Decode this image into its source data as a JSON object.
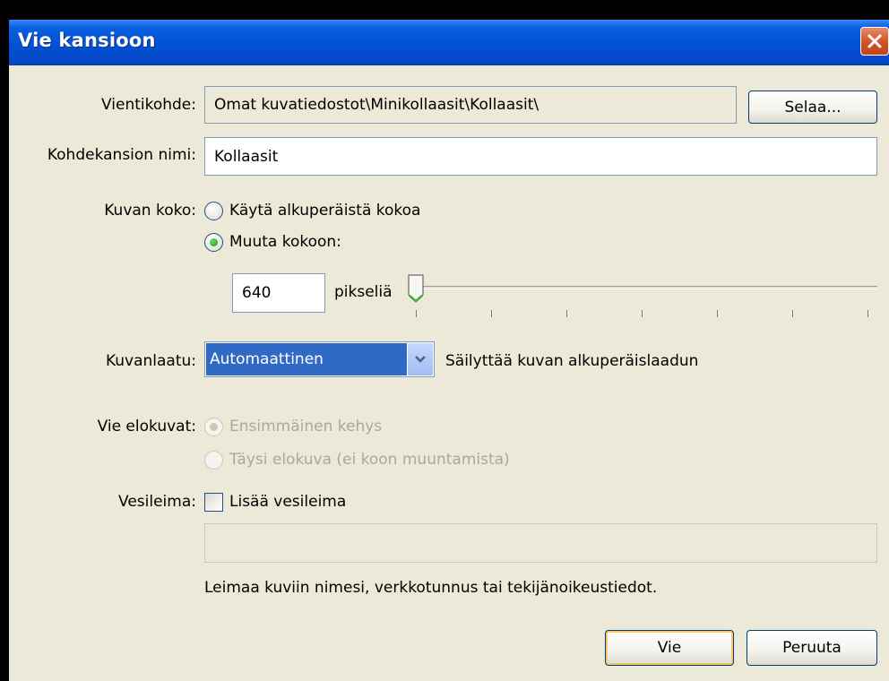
{
  "window": {
    "title": "Vie kansioon"
  },
  "export_target": {
    "label": "Vientikohde:",
    "path": "Omat kuvatiedostot\\Minikollaasit\\Kollaasit\\",
    "browse_label": "Selaa..."
  },
  "folder_name": {
    "label": "Kohdekansion nimi:",
    "value": "Kollaasit"
  },
  "image_size": {
    "label": "Kuvan koko:",
    "option_original": "Käytä alkuperäistä kokoa",
    "option_resize": "Muuta kokoon:",
    "selected": "resize",
    "pixels_value": "640",
    "pixels_unit": "pikseliä",
    "slider_level": 0
  },
  "quality": {
    "label": "Kuvanlaatu:",
    "selected": "Automaattinen",
    "description": "Säilyttää kuvan alkuperäislaadun"
  },
  "movies": {
    "label": "Vie elokuvat:",
    "option_first_frame": "Ensimmäinen kehys",
    "option_full_movie": "Täysi elokuva (ei koon muuntamista)",
    "enabled": false
  },
  "watermark": {
    "label": "Vesileima:",
    "checkbox_label": "Lisää vesileima",
    "checked": false,
    "text_value": "",
    "hint": "Leimaa kuviin nimesi, verkkotunnus tai tekijänoikeustiedot."
  },
  "buttons": {
    "ok_label": "Vie",
    "cancel_label": "Peruuta"
  },
  "colors": {
    "titlebar": "#0352d6",
    "dialog_bg": "#ece9d8",
    "selection": "#316ac5",
    "close": "#d45429"
  }
}
